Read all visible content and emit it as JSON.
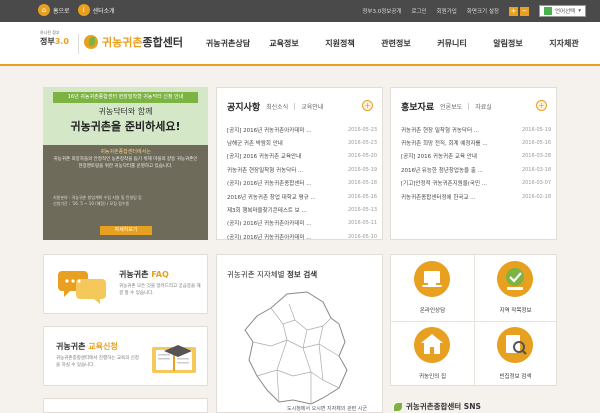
{
  "topbar": {
    "home": "홈으로",
    "center_intro": "센터소개",
    "gov3": "정부3.0정보공개",
    "login": "로그인",
    "join": "회원가입",
    "zoom_label": "화면크기 설정",
    "zoom_in": "+",
    "zoom_out": "−",
    "lang": "언어선택"
  },
  "header": {
    "gov_logo_top": "하나된 정부",
    "gov_logo_main": "정부",
    "gov_logo_num": "3.0",
    "site_name_a": "귀농귀촌",
    "site_name_b": "종합센터",
    "nav": [
      "귀농귀촌상담",
      "교육정보",
      "지원정책",
      "관련정보",
      "커뮤니티",
      "알림정보",
      "지자체관"
    ]
  },
  "banner": {
    "ribbon": "16년 귀농귀촌종합센터 현장밀착형 귀농닥터 신청 안내",
    "sub": "귀농닥터와 함께",
    "title": "귀농귀촌을 준비하세요!",
    "body_head": "귀농귀촌종합센터에서는",
    "body": "귀농귀촌 희망자들의 안정적인 농촌정착을 돕기 위해 마을의 갈등 귀농귀촌인 현장멘토링을 위한 귀농닥터를 운영하고 있습니다.",
    "info_1": "지원분야 : 귀농귀촌 창업계획 수립 지원 및 컨설팅 등",
    "info_2": "신청기간 : '16. 5 ~ 10 (예정) / 모집 접수중",
    "button": "자세히보기"
  },
  "notice": {
    "title": "공지사항",
    "tabs": [
      "최신소식",
      "교육안내"
    ],
    "items": [
      {
        "t": "[공지] 2016년 귀농귀촌아카데미 ...",
        "d": "2016-05-23"
      },
      {
        "t": "남해군 귀촌 박람회 안내",
        "d": "2016-05-23"
      },
      {
        "t": "[공지] 2016 귀농귀촌 교육안내",
        "d": "2016-05-20"
      },
      {
        "t": "귀농귀촌 현장밀착형 귀농닥터 ...",
        "d": "2016-05-19"
      },
      {
        "t": "(공지) 2016년 귀농귀촌종합센터 ...",
        "d": "2016-05-18"
      },
      {
        "t": "2016년 귀농귀촌 창업 대학교 평규 ...",
        "d": "2016-05-16"
      },
      {
        "t": "제3회 행복마을찾기콘테스트 보 ...",
        "d": "2016-05-13"
      },
      {
        "t": "(공지) 2016년 귀농귀촌아카데미 ...",
        "d": "2016-05-11"
      },
      {
        "t": "(공지) 2016년 귀농귀촌아카데미 ...",
        "d": "2016-05-10"
      }
    ]
  },
  "press": {
    "title": "홍보자료",
    "tabs": [
      "언론보도",
      "자료실"
    ],
    "items": [
      {
        "t": "귀농귀촌 현장 밀착형 귀농닥터 ...",
        "d": "2016-05-19"
      },
      {
        "t": "귀농귀촌 희망 전직, 회계 예정자를 ...",
        "d": "2016-05-16"
      },
      {
        "t": "[공지] 2016 귀농귀촌 교육 안내",
        "d": "2016-03-28"
      },
      {
        "t": "2016년 유능한 청년창업농을 출 ...",
        "d": "2016-03-18"
      },
      {
        "t": "[기고]안정적 귀농귀촌지원을(국민 ...",
        "d": "2016-03-07"
      },
      {
        "t": "귀농귀촌종합센터정에 한국교 ...",
        "d": "2016-02-18"
      }
    ]
  },
  "faq": {
    "title_a": "귀농귀촌",
    "title_b": "FAQ",
    "desc": "귀농귀촌 모든 것을 알려드리고 궁금증을 해결 할 수 있습니다."
  },
  "edu": {
    "title_a": "귀농귀촌",
    "title_b": "교육신청",
    "desc": "귀농귀촌종합센터에서 진행하는 교육의 신청을 하실 수 있습니다."
  },
  "map": {
    "title_a": "귀농귀촌 지자체별",
    "title_b": "정보 검색",
    "caption": "도시청에서 오시면 지자체의 관련 시군"
  },
  "quick": [
    {
      "label": "온라인상담"
    },
    {
      "label": "지역 작목정보"
    },
    {
      "label": "귀농인의 집"
    },
    {
      "label": "빈집정보 검색"
    }
  ],
  "sns": {
    "title": "귀농귀촌종합센터 SNS"
  },
  "colors": {
    "accent": "#e8a020",
    "green": "#7cb342",
    "topbar": "#4a4a4a",
    "bg": "#f5f2ee"
  }
}
